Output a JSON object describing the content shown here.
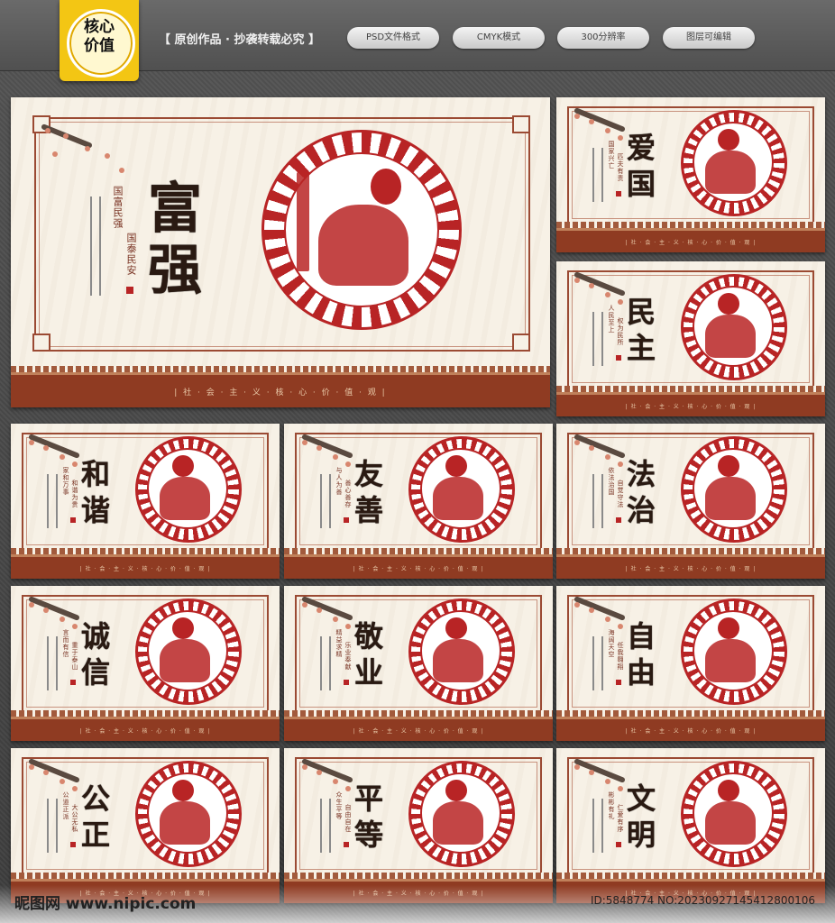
{
  "badge": {
    "line1": "核心",
    "line2": "价值"
  },
  "banner": "【 原创作品 · 抄袭转载必究 】",
  "pills": [
    "PSD文件格式",
    "CMYK模式",
    "300分辨率",
    "图层可编辑"
  ],
  "slogan": "| 社 · 会 · 主 · 义 · 核 · 心 · 价 · 值 · 观 |",
  "panels": [
    {
      "id": "fuqiang",
      "title": [
        "富",
        "强"
      ],
      "verses": [
        "国富民强",
        "国泰民安"
      ]
    },
    {
      "id": "aiguo",
      "title": [
        "爱",
        "国"
      ],
      "verses": [
        "国家兴亡",
        "匹夫有责"
      ]
    },
    {
      "id": "minzhu",
      "title": [
        "民",
        "主"
      ],
      "verses": [
        "人民至上",
        "权为民所"
      ]
    },
    {
      "id": "hexie",
      "title": [
        "和",
        "谐"
      ],
      "verses": [
        "家和万事",
        "和谐为贵"
      ]
    },
    {
      "id": "youshan",
      "title": [
        "友",
        "善"
      ],
      "verses": [
        "与人为善",
        "善心善存"
      ]
    },
    {
      "id": "fazhi",
      "title": [
        "法",
        "治"
      ],
      "verses": [
        "依法治国",
        "自觉守法"
      ]
    },
    {
      "id": "chengxin",
      "title": [
        "诚",
        "信"
      ],
      "verses": [
        "言而有信",
        "重于泰山"
      ]
    },
    {
      "id": "jingye",
      "title": [
        "敬",
        "业"
      ],
      "verses": [
        "精益求精",
        "乐业奉献"
      ]
    },
    {
      "id": "ziyou",
      "title": [
        "自",
        "由"
      ],
      "verses": [
        "海阔天空",
        "任我翱翔"
      ]
    },
    {
      "id": "gongzheng",
      "title": [
        "公",
        "正"
      ],
      "verses": [
        "公道正派",
        "大公无私"
      ]
    },
    {
      "id": "pingdeng",
      "title": [
        "平",
        "等"
      ],
      "verses": [
        "众生平等",
        "自由自在"
      ]
    },
    {
      "id": "wenming",
      "title": [
        "文",
        "明"
      ],
      "verses": [
        "彬彬有礼",
        "仁爱有序"
      ]
    }
  ],
  "watermark": {
    "site": "昵图网 www.nipic.com",
    "id": "ID:5848774 NO:20230927145412800106"
  },
  "colors": {
    "accent": "#b82425",
    "footer": "#8f3b22",
    "badge": "#f3c614"
  }
}
